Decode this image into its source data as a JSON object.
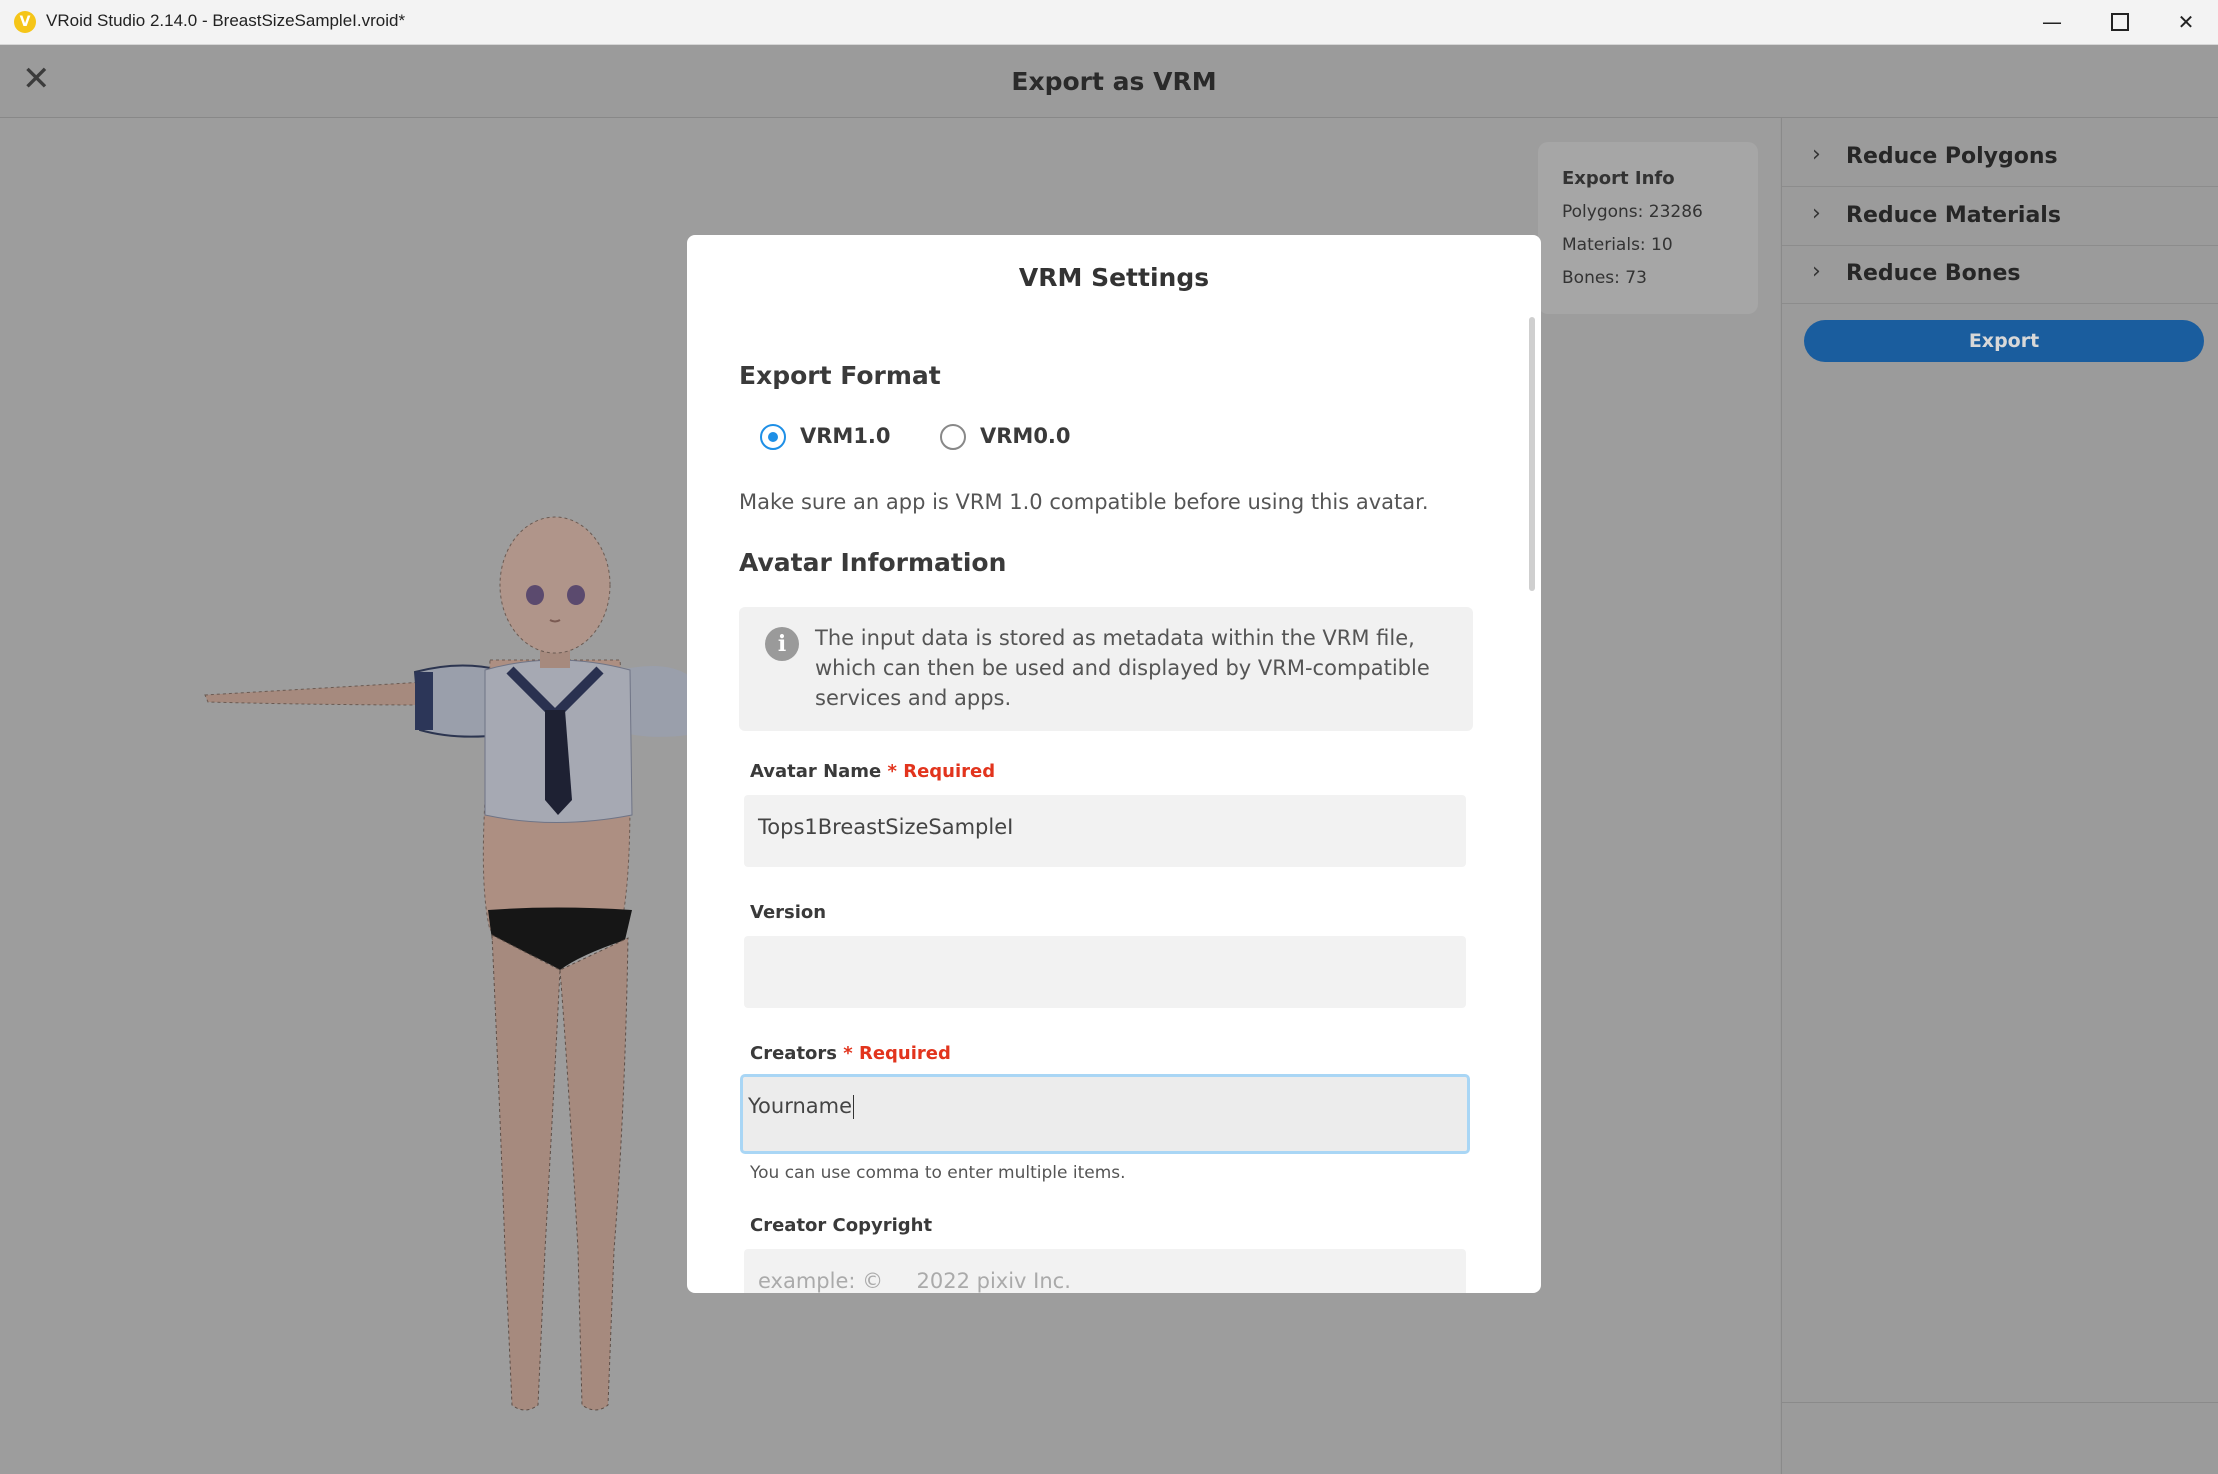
{
  "window": {
    "title": "VRoid Studio 2.14.0 - BreastSizeSampleI.vroid*",
    "logo_glyph": "V",
    "minimize_glyph": "—",
    "close_glyph": "✕"
  },
  "header": {
    "close_glyph": "✕",
    "title": "Export as VRM"
  },
  "export_info": {
    "title": "Export Info",
    "polygons": "Polygons: 23286",
    "materials": "Materials: 10",
    "bones": "Bones: 73"
  },
  "side_panel": {
    "items": [
      {
        "label": "Reduce Polygons",
        "icon": "chevron-right-icon"
      },
      {
        "label": "Reduce Materials",
        "icon": "chevron-right-icon"
      },
      {
        "label": "Reduce Bones",
        "icon": "chevron-right-icon"
      }
    ],
    "export_label": "Export"
  },
  "modal": {
    "title": "VRM Settings",
    "export_format": {
      "heading": "Export Format",
      "options": [
        {
          "label": "VRM1.0",
          "selected": true
        },
        {
          "label": "VRM0.0",
          "selected": false
        }
      ],
      "note": "Make sure an app is VRM 1.0 compatible before using this avatar."
    },
    "avatar_info": {
      "heading": "Avatar Information",
      "info_icon": "i",
      "info_text": "The input data is stored as metadata within the VRM file, which can then be used and displayed by VRM-compatible services and apps."
    },
    "fields": {
      "avatar_name": {
        "label": "Avatar Name",
        "required": "* Required",
        "value": "Tops1BreastSizeSampleI"
      },
      "version": {
        "label": "Version",
        "value": ""
      },
      "creators": {
        "label": "Creators",
        "required": "* Required",
        "value": "Yourname",
        "hint": "You can use comma to enter multiple items."
      },
      "creator_copyright": {
        "label": "Creator Copyright",
        "placeholder": "example: ©     2022 pixiv Inc."
      }
    }
  },
  "colors": {
    "accent": "#1e8fe6",
    "required": "#e2341d",
    "export_button": "#1a5d9e",
    "overlay": "#9b9b9b"
  }
}
